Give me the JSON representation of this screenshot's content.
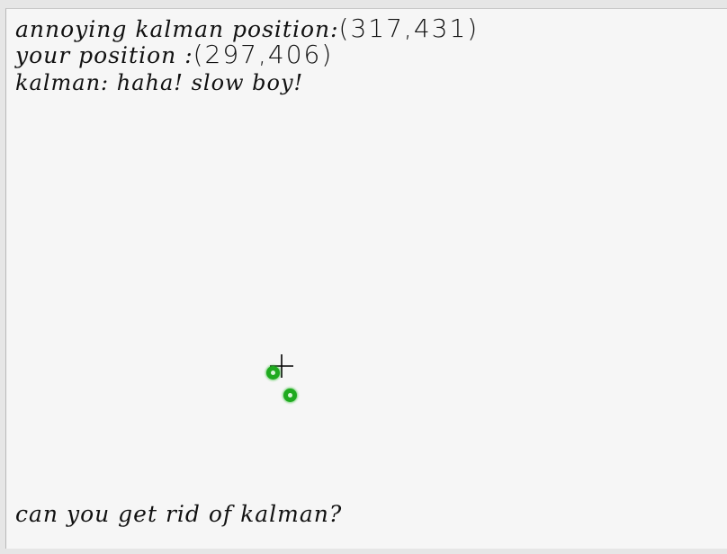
{
  "hud": {
    "kalman_label": "annoying kalman position:",
    "kalman_coords": "(317,431)",
    "your_label": "your position :",
    "your_coords": "(297,406)",
    "taunt": "kalman: haha! slow boy!"
  },
  "footer": {
    "prompt": "can you get rid of kalman?"
  },
  "sprites": {
    "crosshair_icon": "crosshair-icon",
    "player_color": "#1faa1f",
    "kalman_color": "#1faa1f"
  }
}
